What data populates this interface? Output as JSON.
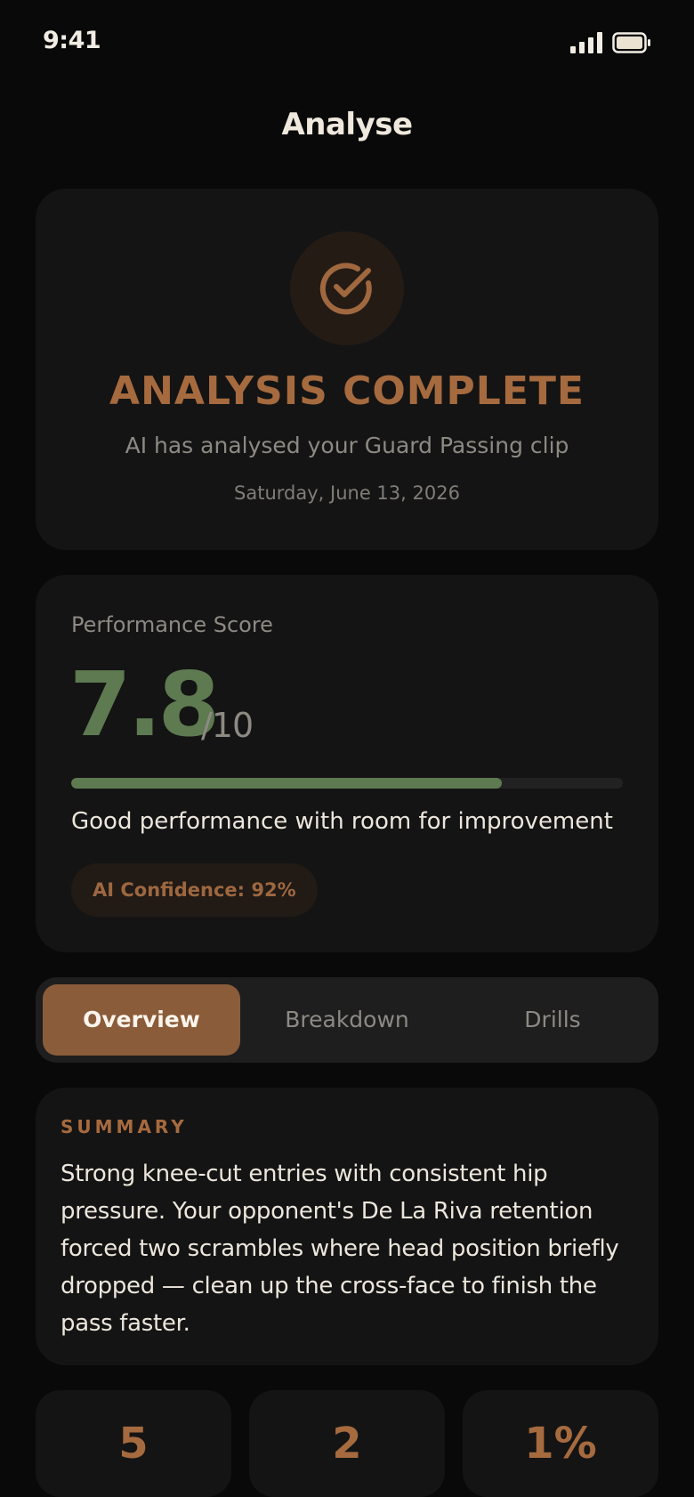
{
  "status_bar": {
    "time": "9:41"
  },
  "header": {
    "title": "Analyse"
  },
  "hero": {
    "title": "ANALYSIS COMPLETE",
    "subtitle": "AI has analysed your Guard Passing clip",
    "date": "Saturday, June 13, 2026"
  },
  "score": {
    "label": "Performance Score",
    "value": "7.8",
    "max": "/10",
    "progress_fraction": 0.78,
    "description": "Good performance with room for improvement",
    "confidence": "AI Confidence: 92%"
  },
  "tabs": [
    {
      "label": "Overview",
      "active": true
    },
    {
      "label": "Breakdown",
      "active": false
    },
    {
      "label": "Drills",
      "active": false
    }
  ],
  "summary": {
    "label": "SUMMARY",
    "text": "Strong knee-cut entries with consistent hip pressure. Your opponent's De La Riva retention forced two scrambles where head position briefly dropped — clean up the cross-face to finish the pass faster."
  },
  "stats": [
    {
      "value": "5"
    },
    {
      "value": "2"
    },
    {
      "value": "1%"
    }
  ],
  "colors": {
    "accent": "#a66a3f",
    "score_green": "#5d7a51",
    "background": "#090909",
    "card": "#141414"
  },
  "icons": {
    "hero_icon": "check-circle-icon",
    "signal": "signal-icon",
    "battery": "battery-icon"
  }
}
